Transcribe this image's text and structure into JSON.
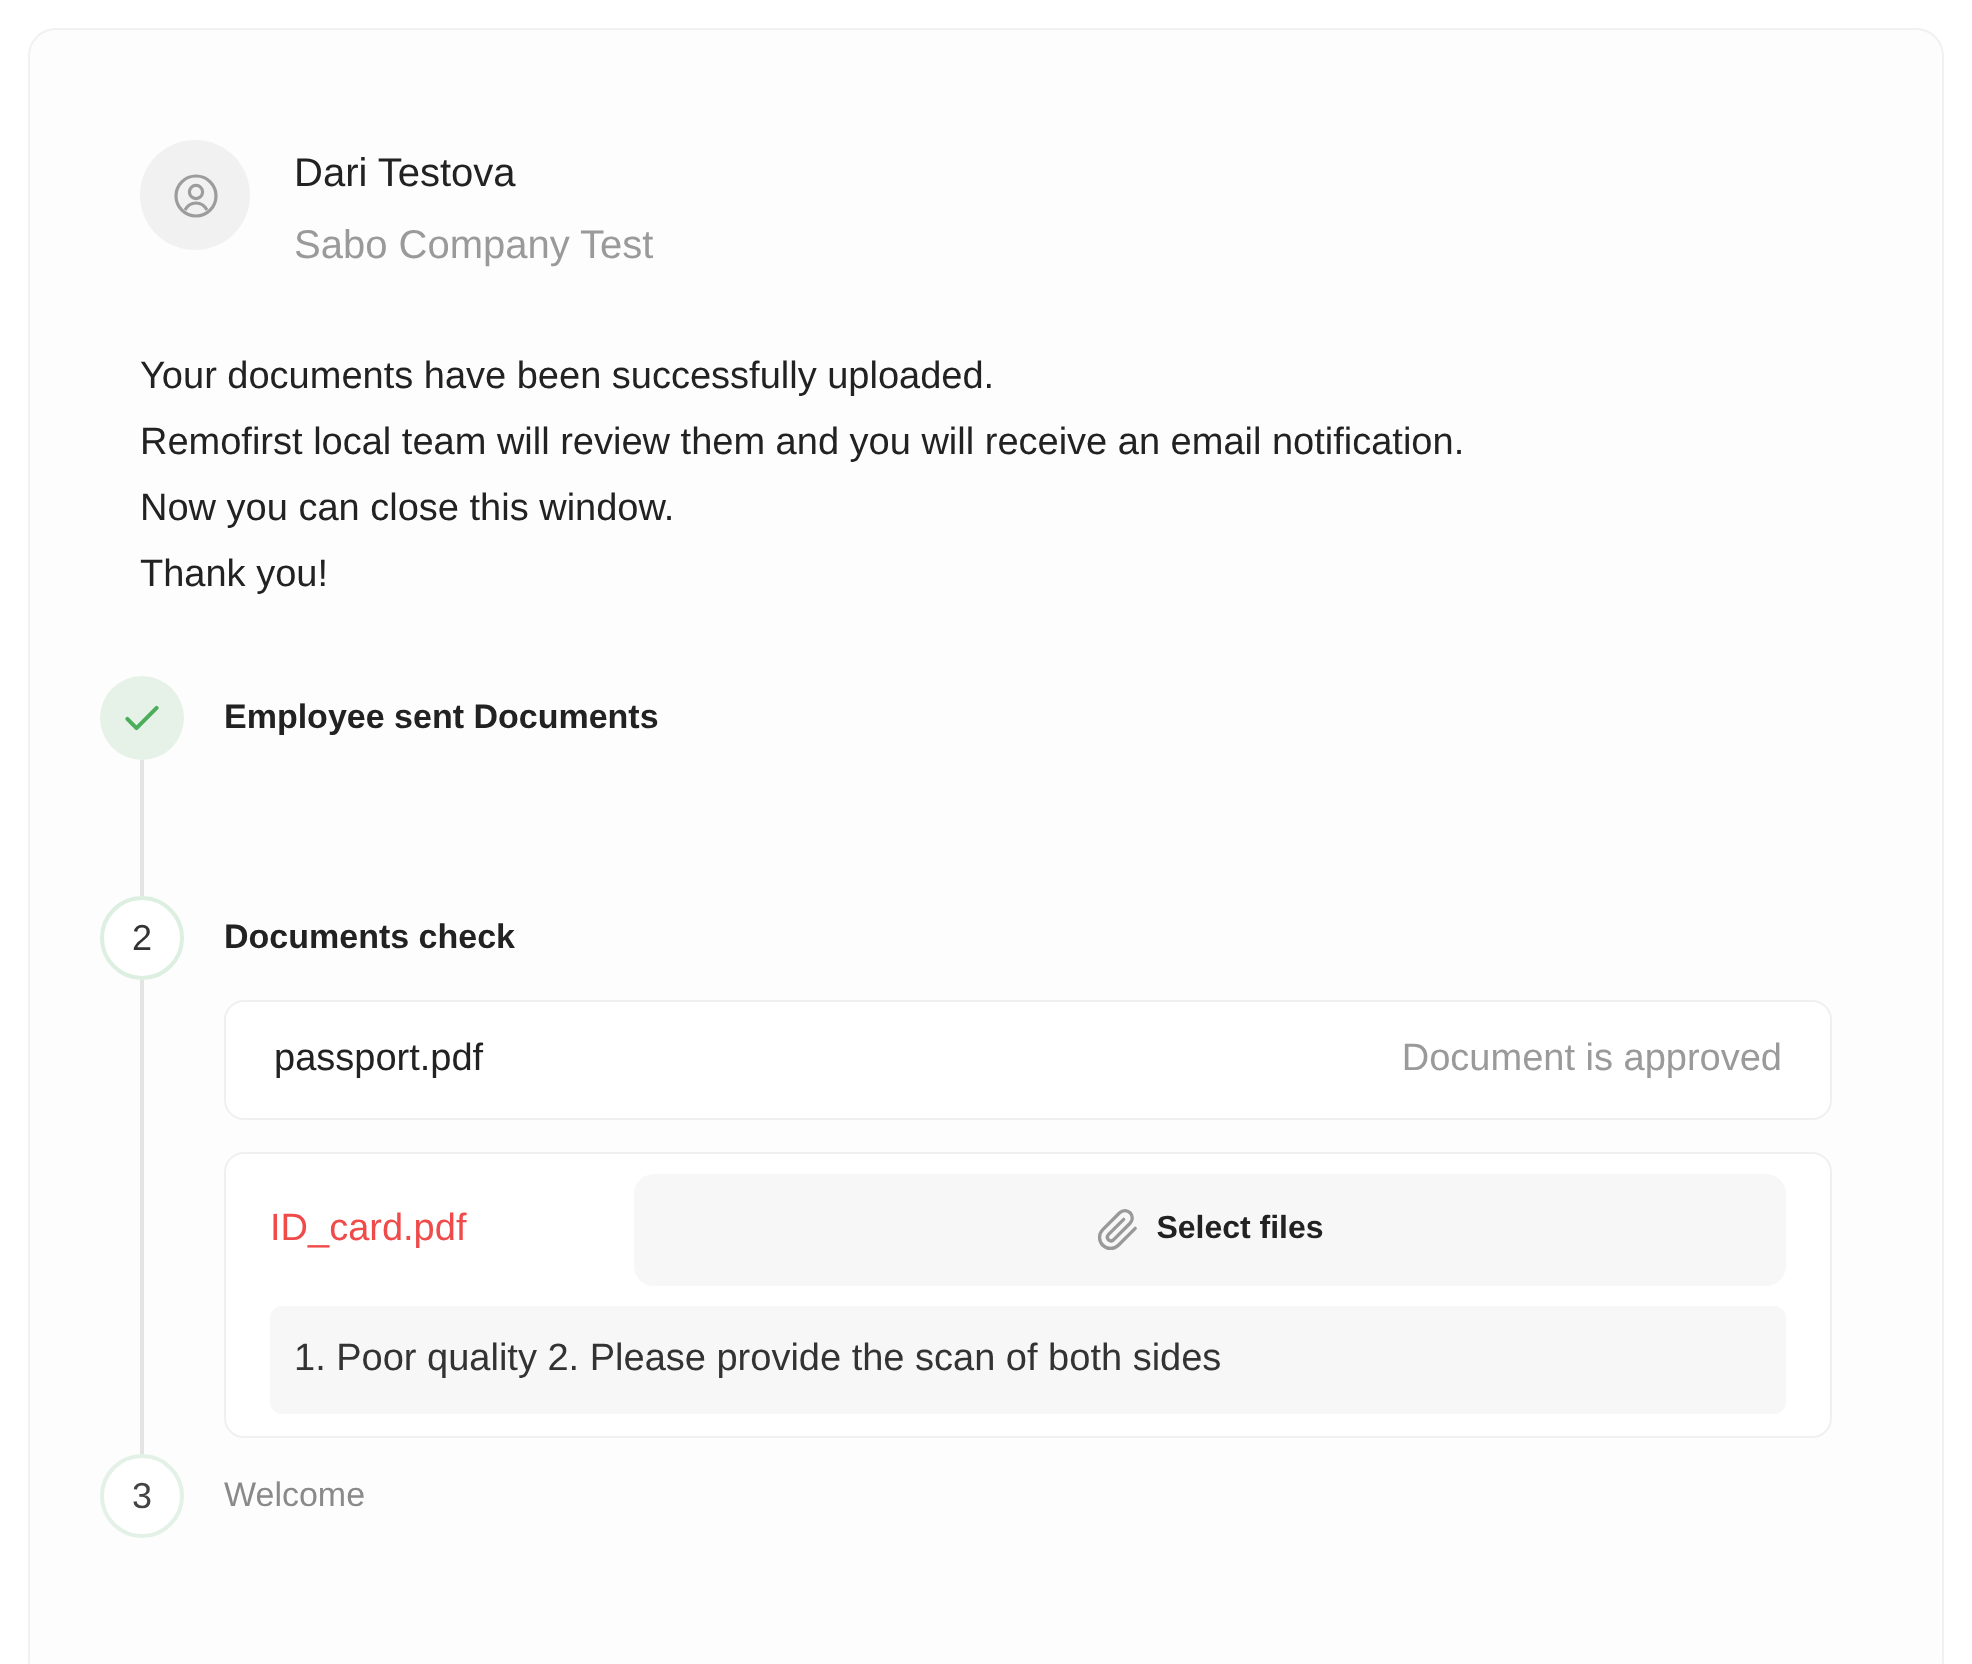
{
  "user": {
    "name": "Dari Testova",
    "company": "Sabo Company Test"
  },
  "message": [
    "Your documents have been successfully uploaded.",
    "Remofirst local team will review them and you will receive an email notification.",
    "Now you can close this window.",
    "Thank you!"
  ],
  "steps": [
    {
      "done": true,
      "label": "Employee sent Documents"
    },
    {
      "done": false,
      "current": true,
      "number": "2",
      "label": "Documents check",
      "documents": [
        {
          "kind": "approved",
          "name": "passport.pdf",
          "status_text": "Document is approved"
        },
        {
          "kind": "rejected",
          "name": "ID_card.pdf",
          "button": "Select files",
          "comment": "1. Poor quality 2. Please provide the scan of both sides"
        }
      ]
    },
    {
      "done": false,
      "current": false,
      "number": "3",
      "label": "Welcome"
    }
  ]
}
